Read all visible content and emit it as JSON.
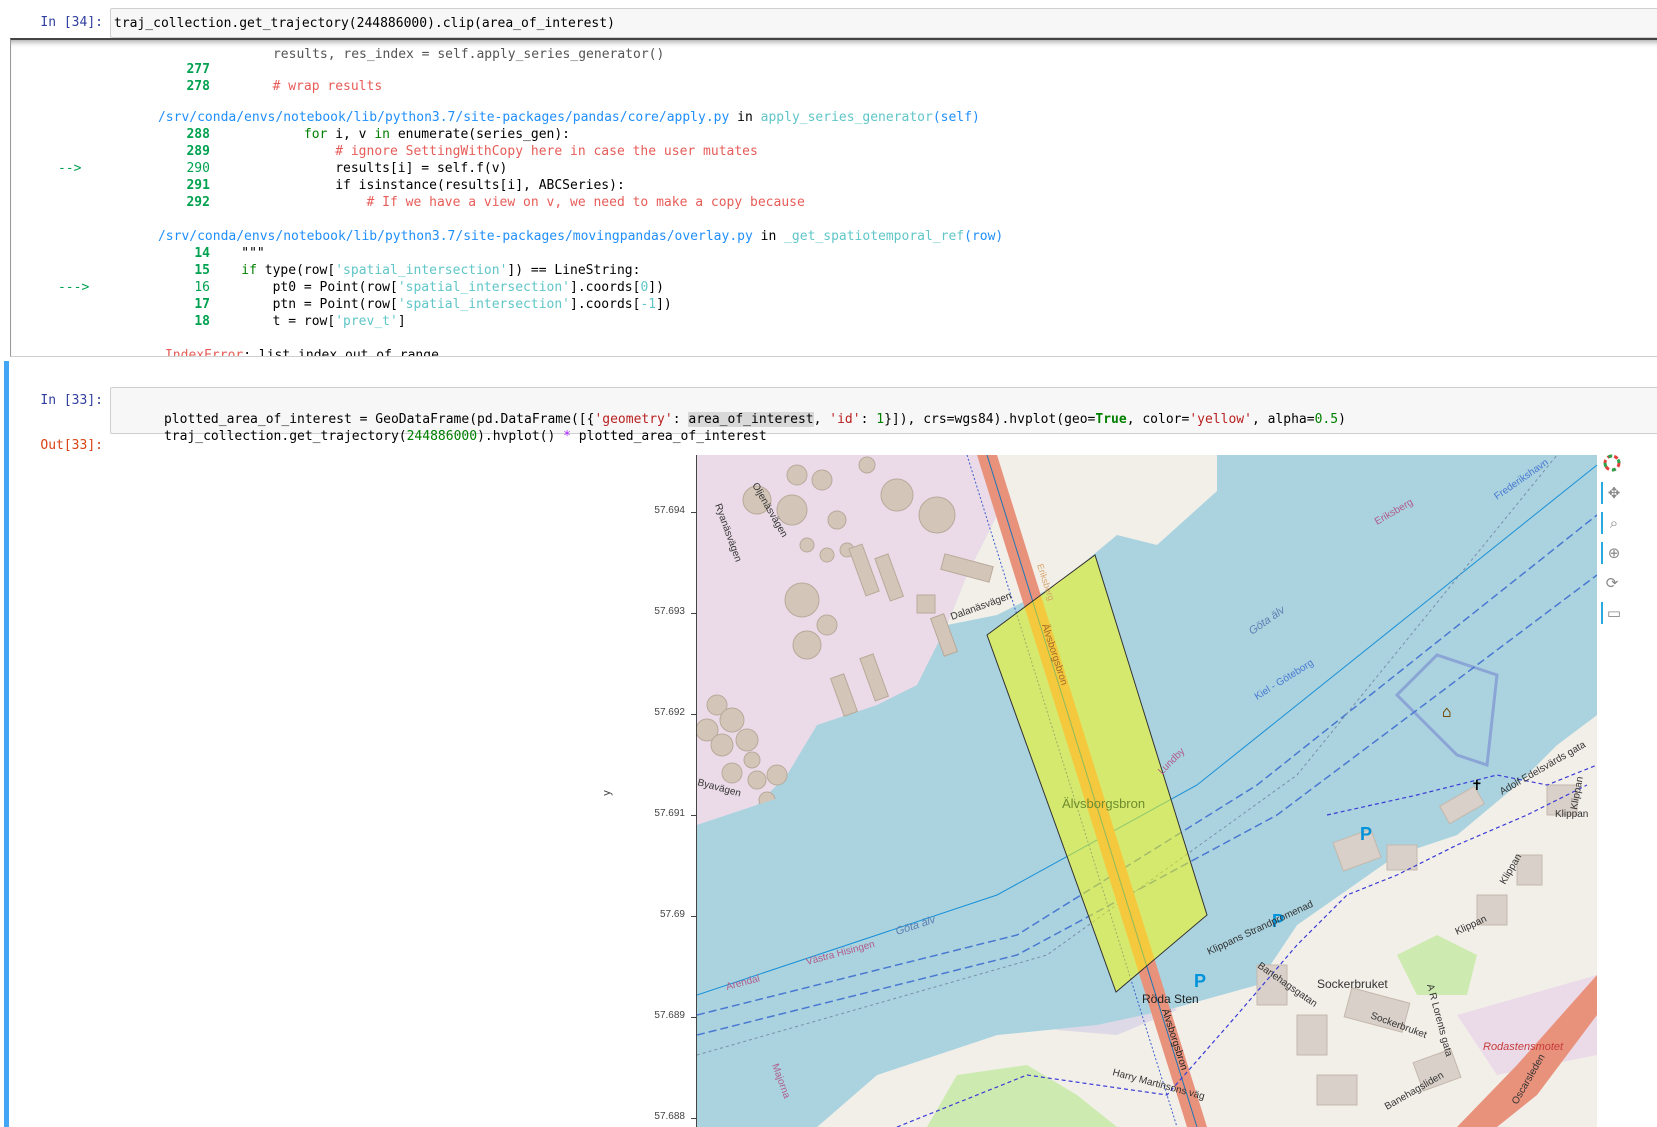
{
  "cell34": {
    "prompt": "In [34]:",
    "code": "traj_collection.get_trajectory(244886000).clip(area_of_interest)",
    "traceback": {
      "partial_line": "results, res_index = self.apply_series_generator()",
      "block1": [
        {
          "no": "277",
          "text": ""
        },
        {
          "no": "278",
          "text": "        # wrap results"
        }
      ],
      "file2_path": "/srv/conda/envs/notebook/lib/python3.7/site-packages/pandas/core/apply.py",
      "file2_in": " in ",
      "file2_func": "apply_series_generator",
      "file2_args": "(self)",
      "block2": [
        {
          "no": "288",
          "arrow": "",
          "text": "            for i, v in enumerate(series_gen):"
        },
        {
          "no": "289",
          "arrow": "",
          "text": "                # ignore SettingWithCopy here in case the user mutates"
        },
        {
          "no": "290",
          "arrow": "--> ",
          "text": "                results[i] = self.f(v)"
        },
        {
          "no": "291",
          "arrow": "",
          "text": "                if isinstance(results[i], ABCSeries):"
        },
        {
          "no": "292",
          "arrow": "",
          "text": "                    # If we have a view on v, we need to make a copy because"
        }
      ],
      "file3_path": "/srv/conda/envs/notebook/lib/python3.7/site-packages/movingpandas/overlay.py",
      "file3_in": " in ",
      "file3_func": "_get_spatiotemporal_ref",
      "file3_args": "(row)",
      "block3": [
        {
          "no": "14",
          "arrow": "",
          "text": "    \"\"\""
        },
        {
          "no": "15",
          "arrow": "",
          "text": "    if type(row['spatial_intersection']) == LineString:"
        },
        {
          "no": "16",
          "arrow": "---> ",
          "text": "        pt0 = Point(row['spatial_intersection'].coords[0])"
        },
        {
          "no": "17",
          "arrow": "",
          "text": "        ptn = Point(row['spatial_intersection'].coords[-1])"
        },
        {
          "no": "18",
          "arrow": "",
          "text": "        t = row['prev_t']"
        }
      ],
      "error_name": "IndexError",
      "error_msg": ": list index out of range"
    }
  },
  "cell33": {
    "prompt": "In [33]:",
    "out_prompt": "Out[33]:",
    "line1_a": "plotted_area_of_interest = GeoDataFrame(pd.DataFrame([{",
    "line1_s1": "'geometry'",
    "line1_b": ": ",
    "line1_hl": "area_of_interest",
    "line1_c": ", ",
    "line1_s2": "'id'",
    "line1_d": ": ",
    "line1_n1": "1",
    "line1_e": "}]), crs=wgs84).hvplot(geo=",
    "line1_k1": "True",
    "line1_f": ", color=",
    "line1_s3": "'yellow'",
    "line1_g": ", alpha=",
    "line1_n2": "0.5",
    "line1_h": ")",
    "line2_a": "traj_collection.get_trajectory(",
    "line2_n": "244886000",
    "line2_b": ").hvplot() ",
    "line2_op": "*",
    "line2_c": " plotted_area_of_interest"
  },
  "plot": {
    "ylabel": "y",
    "yticks": [
      "57.694",
      "57.693",
      "57.692",
      "57.691",
      "57.69",
      "57.689",
      "57.688"
    ],
    "map_labels": {
      "alvsborgsbron_center": "Älvsborgsbron",
      "alvsborgsbron_road1": "Älvsborgsbron",
      "alvsborgsbron_road2": "Älvsborgsbron",
      "gota_alv1": "Göta älv",
      "gota_alv2": "Göta älv",
      "kiel": "Kiel - Göteborg",
      "vastra": "Västra Hisingen",
      "arendal": "Arendal",
      "eriksberg": "Eriksberg",
      "frederikshavn": "Frederikshavn",
      "dalanasvagen": "Dalanäsvägen",
      "oljenasvagen": "Oljenäsvägen",
      "ryanasvagen": "Ryanäsvägen",
      "byavagen": "Byavägen",
      "lundby": "Lundby",
      "roda_sten": "Röda Sten",
      "klippans_strandpromenad": "Klippans Strandpromenad",
      "banehagsgatan": "Banehagsgatan",
      "sockerbruket": "Sockerbruket",
      "sockerbruket_street": "Sockerbruket",
      "ar_lorentz": "A R Lorents gata",
      "rodastensmotet": "Rodastensmotet",
      "harry": "Harry Martinsons väg",
      "banehagsliden": "Banehagsliden",
      "oscarsleden": "Oscarsleden",
      "klippan1": "Klippan",
      "klippan2": "Klippan",
      "klippan3": "Klippan",
      "klippan4": "Klippan",
      "adolf": "Adolf Edelsvärds gata",
      "majorna": "Majorna",
      "eriksberg_road": "Eriksberg",
      "parking": "P"
    },
    "area_color": "#ffff00",
    "trajectory_color": "#1f77b4",
    "toolbar": [
      "bokeh-logo-icon",
      "pan-icon",
      "box-zoom-icon",
      "wheel-zoom-icon",
      "reset-icon",
      "hover-icon"
    ]
  }
}
